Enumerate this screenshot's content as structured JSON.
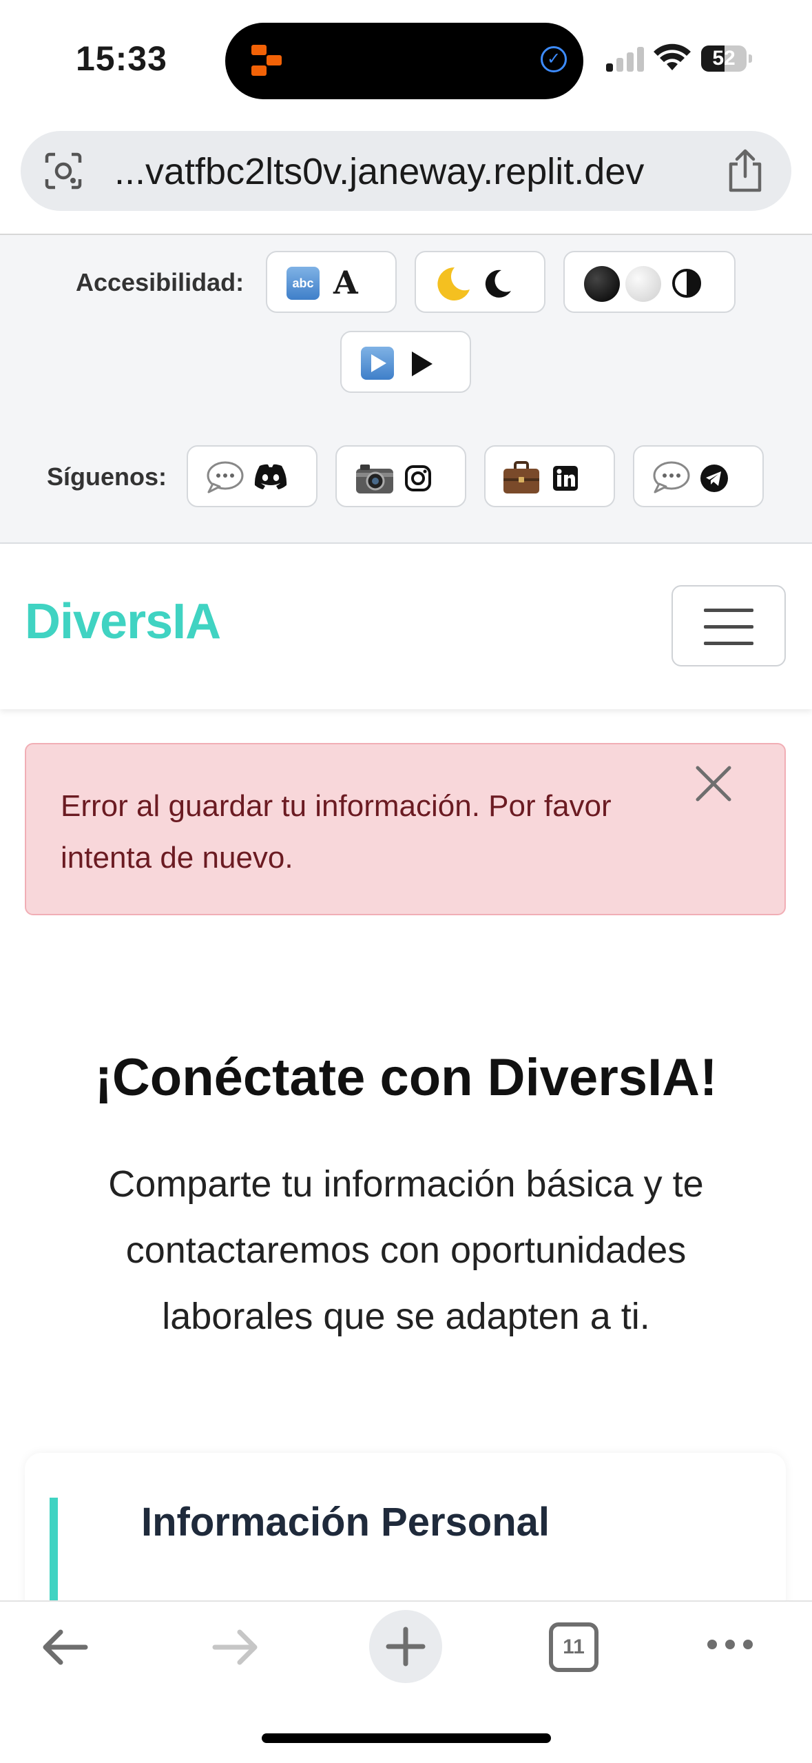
{
  "status_bar": {
    "time": "15:33",
    "battery": "52",
    "battery_level": 0.52
  },
  "browser": {
    "url": "...vatfbc2lts0v.janeway.replit.dev",
    "tab_count": "11"
  },
  "accessibility_bar": {
    "label": "Accesibilidad:",
    "buttons": [
      {
        "emoji": "abc",
        "glyph": "A",
        "icon": "text-size-icon"
      },
      {
        "emoji": "moon",
        "glyph": "moon",
        "icon": "dark-mode-icon"
      },
      {
        "emoji": "circles",
        "glyph": "half-circle",
        "icon": "contrast-icon"
      },
      {
        "emoji": "play",
        "glyph": "play",
        "icon": "play-icon"
      }
    ]
  },
  "social_bar": {
    "label": "Síguenos:",
    "buttons": [
      {
        "icon": "discord-icon"
      },
      {
        "icon": "instagram-icon"
      },
      {
        "icon": "linkedin-icon"
      },
      {
        "icon": "telegram-icon"
      }
    ]
  },
  "navbar": {
    "brand": "DiversIA"
  },
  "alert": {
    "message": "Error al guardar tu información. Por favor intenta de nuevo."
  },
  "hero": {
    "title": "¡Conéctate con DiversIA!",
    "text": "Comparte tu información básica y te contactaremos con oportunidades laborales que se adapten a ti."
  },
  "card": {
    "title": "Información Personal"
  },
  "colors": {
    "brand": "#40d3c2",
    "alert_bg": "#f8d7da",
    "alert_text": "#6b1b22"
  }
}
